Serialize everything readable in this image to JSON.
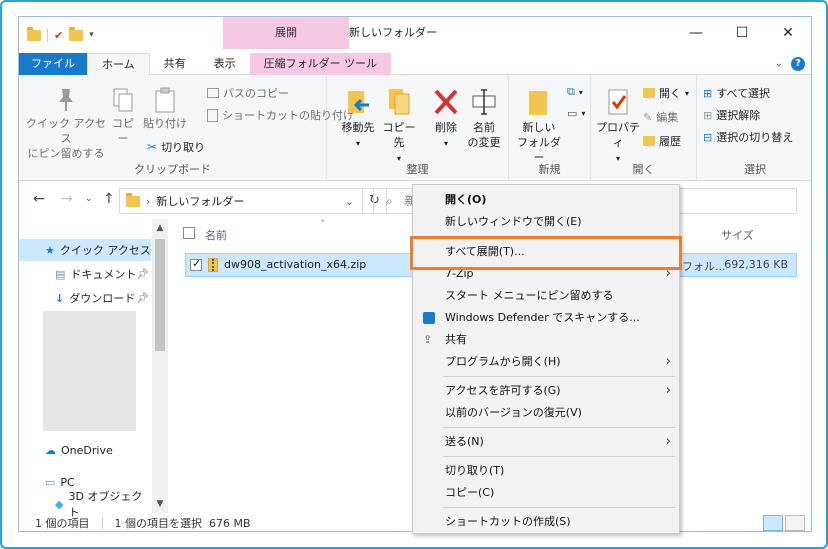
{
  "window": {
    "title": "新しいフォルダー",
    "context_tab_header": "展開",
    "controls": {
      "minimize": "—",
      "maximize": "☐",
      "close": "✕"
    }
  },
  "tabs": [
    {
      "label": "ファイル"
    },
    {
      "label": "ホーム"
    },
    {
      "label": "共有"
    },
    {
      "label": "表示"
    },
    {
      "label": "圧縮フォルダー ツール"
    }
  ],
  "ribbon": {
    "clipboard": {
      "label": "クリップボード",
      "pin_line1": "クイック アクセス",
      "pin_line2": "にピン留めする",
      "copy": "コピー",
      "paste": "貼り付け",
      "copy_path": "パスのコピー",
      "paste_shortcut": "ショートカットの貼り付け",
      "cut": "切り取り"
    },
    "organize": {
      "label": "整理",
      "move_to": "移動先",
      "copy_to": "コピー先",
      "delete": "削除",
      "rename_line1": "名前",
      "rename_line2": "の変更"
    },
    "new": {
      "label": "新規",
      "new_folder_line1": "新しい",
      "new_folder_line2": "フォルダー"
    },
    "open": {
      "label": "開く",
      "properties": "プロパティ",
      "open": "開く",
      "edit": "編集",
      "history": "履歴"
    },
    "select": {
      "label": "選択",
      "select_all": "すべて選択",
      "select_none": "選択解除",
      "invert": "選択の切り替え"
    }
  },
  "address": {
    "path": "新しいフォルダー",
    "search_placeholder": "新"
  },
  "nav": {
    "items": [
      {
        "label": "クイック アクセス"
      },
      {
        "label": "ドキュメント"
      },
      {
        "label": "ダウンロード"
      },
      {
        "label": "OneDrive"
      },
      {
        "label": "PC"
      },
      {
        "label": "3D オブジェクト"
      }
    ]
  },
  "list": {
    "col_name": "名前",
    "col_size": "サイズ",
    "file": {
      "name": "dw908_activation_x64.zip",
      "type_partial": "フォル...",
      "size": "692,316 KB"
    }
  },
  "status": {
    "count": "1 個の項目",
    "selected": "1 個の項目を選択  676 MB"
  },
  "context_menu": {
    "items": [
      {
        "label": "開く(O)"
      },
      {
        "label": "新しいウィンドウで開く(E)"
      },
      {
        "label": "すべて展開(T)..."
      },
      {
        "label": "7-Zip"
      },
      {
        "label": "スタート メニューにピン留めする"
      },
      {
        "label": "Windows Defender でスキャンする..."
      },
      {
        "label": "共有"
      },
      {
        "label": "プログラムから開く(H)"
      },
      {
        "label": "アクセスを許可する(G)"
      },
      {
        "label": "以前のバージョンの復元(V)"
      },
      {
        "label": "送る(N)"
      },
      {
        "label": "切り取り(T)"
      },
      {
        "label": "コピー(C)"
      },
      {
        "label": "ショートカットの作成(S)"
      }
    ]
  },
  "colors": {
    "accent": "#1979ca",
    "highlight_box": "#ed7d31",
    "context_tab": "#f6c8e4",
    "selection": "#cce8ff"
  }
}
